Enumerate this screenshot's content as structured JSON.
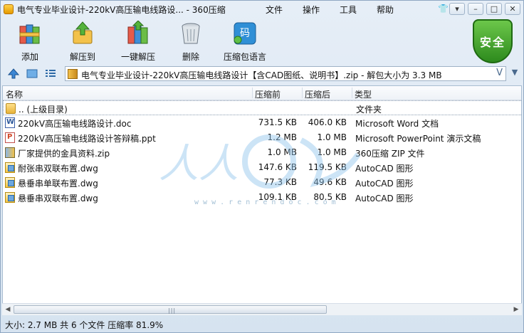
{
  "window": {
    "title": "电气专业毕业设计-220kV高压输电线路设... - 360压缩",
    "menus": [
      "文件",
      "操作",
      "工具",
      "帮助"
    ]
  },
  "toolbar": {
    "buttons": [
      {
        "label": "添加",
        "icon": "add-books-icon"
      },
      {
        "label": "解压到",
        "icon": "extract-to-icon"
      },
      {
        "label": "一键解压",
        "icon": "quick-extract-icon"
      },
      {
        "label": "删除",
        "icon": "trash-icon"
      },
      {
        "label": "压缩包语言",
        "icon": "language-icon"
      }
    ],
    "security_badge": "安全",
    "language_glyph": "码"
  },
  "address": {
    "path": "电气专业毕业设计-220kV高压输电线路设计【含CAD图纸、说明书】.zip - 解包大小为 3.3 MB"
  },
  "columns": {
    "name": "名称",
    "before": "压缩前",
    "after": "压缩后",
    "type": "类型"
  },
  "files": [
    {
      "name": ".. (上级目录)",
      "before": "",
      "after": "",
      "type": "文件夹",
      "icon": "folder-icon"
    },
    {
      "name": "220kV高压输电线路设计.doc",
      "before": "731.5 KB",
      "after": "406.0 KB",
      "type": "Microsoft Word 文档",
      "icon": "word-icon"
    },
    {
      "name": "220kV高压输电线路设计答辩稿.ppt",
      "before": "1.2 MB",
      "after": "1.0 MB",
      "type": "Microsoft PowerPoint 演示文稿",
      "icon": "ppt-icon"
    },
    {
      "name": "厂家提供的金具资料.zip",
      "before": "1.0 MB",
      "after": "1.0 MB",
      "type": "360压缩 ZIP 文件",
      "icon": "zip-icon"
    },
    {
      "name": "耐张串双联布置.dwg",
      "before": "147.6 KB",
      "after": "119.5 KB",
      "type": "AutoCAD 图形",
      "icon": "dwg-icon"
    },
    {
      "name": "悬垂串单联布置.dwg",
      "before": "77.3 KB",
      "after": "49.6 KB",
      "type": "AutoCAD 图形",
      "icon": "dwg-icon"
    },
    {
      "name": "悬垂串双联布置.dwg",
      "before": "109.1 KB",
      "after": "80.5 KB",
      "type": "AutoCAD 图形",
      "icon": "dwg-icon"
    }
  ],
  "status": "大小: 2.7 MB 共 6 个文件 压缩率 81.9%",
  "watermark": {
    "text": "人人",
    "url": "w w w . r e n r e n d o c . c o m"
  }
}
